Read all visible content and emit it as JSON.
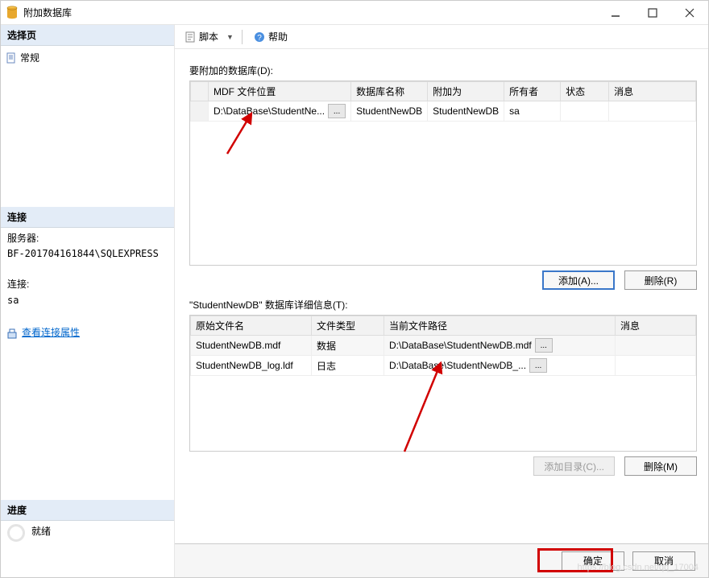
{
  "titlebar": {
    "title": "附加数据库"
  },
  "left": {
    "select_page": "选择页",
    "general": "常规",
    "connection_hdr": "连接",
    "server_label": "服务器:",
    "server_value": "BF-201704161844\\SQLEXPRESS",
    "conn_label": "连接:",
    "conn_value": "sa",
    "view_props": "查看连接属性",
    "progress_hdr": "进度",
    "ready": "就绪"
  },
  "toolbar": {
    "script": "脚本",
    "help": "帮助"
  },
  "top": {
    "legend": "要附加的数据库(D):",
    "cols": {
      "mdf": "MDF 文件位置",
      "dbname": "数据库名称",
      "attachas": "附加为",
      "owner": "所有者",
      "status": "状态",
      "msg": "消息"
    },
    "row": {
      "mdf": "D:\\DataBase\\StudentNe...",
      "dbname": "StudentNewDB",
      "attachas": "StudentNewDB",
      "owner": "sa"
    },
    "add_btn": "添加(A)...",
    "del_btn": "删除(R)"
  },
  "bottom": {
    "legend": "\"StudentNewDB\" 数据库详细信息(T):",
    "cols": {
      "orig": "原始文件名",
      "ftype": "文件类型",
      "cur": "当前文件路径",
      "msg": "消息"
    },
    "rows": [
      {
        "orig": "StudentNewDB.mdf",
        "ftype": "数据",
        "cur": "D:\\DataBase\\StudentNewDB.mdf"
      },
      {
        "orig": "StudentNewDB_log.ldf",
        "ftype": "日志",
        "cur": "D:\\DataBase\\StudentNewDB_..."
      }
    ],
    "addcat_btn": "添加目录(C)...",
    "del_btn": "删除(M)"
  },
  "footer": {
    "ok": "确定",
    "cancel": "取消"
  },
  "watermark": "https://blog.csdn.net/qq_17004"
}
